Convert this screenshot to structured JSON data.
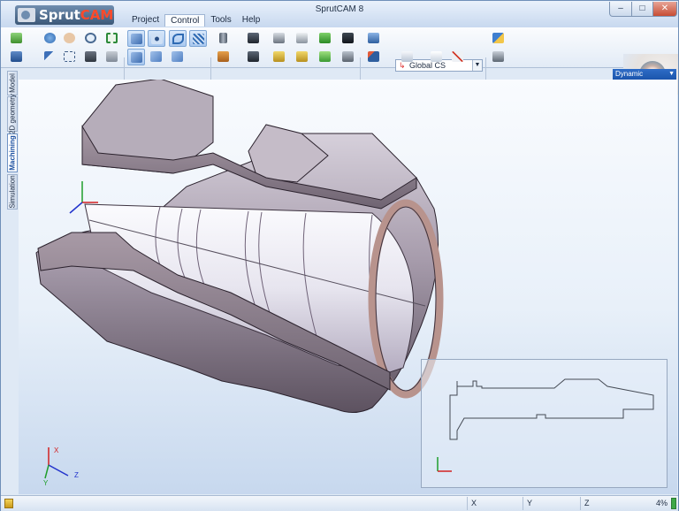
{
  "app": {
    "logo_text_a": "Sprut",
    "logo_text_b": "CAM",
    "window_title": "SprutCAM 8",
    "window_buttons": [
      "–",
      "□",
      "✕"
    ]
  },
  "menu": {
    "items": [
      {
        "label": "Project",
        "active": false
      },
      {
        "label": "Control",
        "active": true
      },
      {
        "label": "Tools",
        "active": false
      },
      {
        "label": "Help",
        "active": false
      }
    ]
  },
  "toolbar": {
    "coordinate_system": "Global CS",
    "buttons": [
      "import-icon",
      "rotate-view-icon",
      "pan-view-icon",
      "zoom-view-icon",
      "zoom-fit-icon",
      "save-icon",
      "select-arrow-icon",
      "select-window-icon",
      "snapshot-icon",
      "print-icon",
      "shaded-view-icon",
      "point-select-icon",
      "curve-select-icon",
      "surface-select-icon",
      "shaded-view-2-icon",
      "filter-select-icon",
      "filter-select-2-icon",
      "tool-holder-icon",
      "op-roughing-icon",
      "op-finishing-icon",
      "op-drilling-icon",
      "op-threading-icon",
      "op-grooving-icon",
      "op-parting-icon",
      "op-facing-icon",
      "op-boring-icon",
      "op-tilt-icon",
      "workpiece-icon",
      "machine-icon",
      "cs-icon",
      "cs-edit-icon",
      "cs-delete-icon",
      "tool-settings-icon"
    ]
  },
  "view": {
    "mode": "Dynamic"
  },
  "sidebar": {
    "tabs": [
      {
        "label": "Model",
        "active": false
      },
      {
        "label": "2D geometry",
        "active": false
      },
      {
        "label": "Machining",
        "active": true
      },
      {
        "label": "Simulation",
        "active": false
      }
    ]
  },
  "axes": {
    "x": "X",
    "y": "Y",
    "z": "Z"
  },
  "statusbar": {
    "x_label": "X",
    "y_label": "Y",
    "z_label": "Z",
    "progress_label": "4%",
    "progress_value": 0.04
  }
}
